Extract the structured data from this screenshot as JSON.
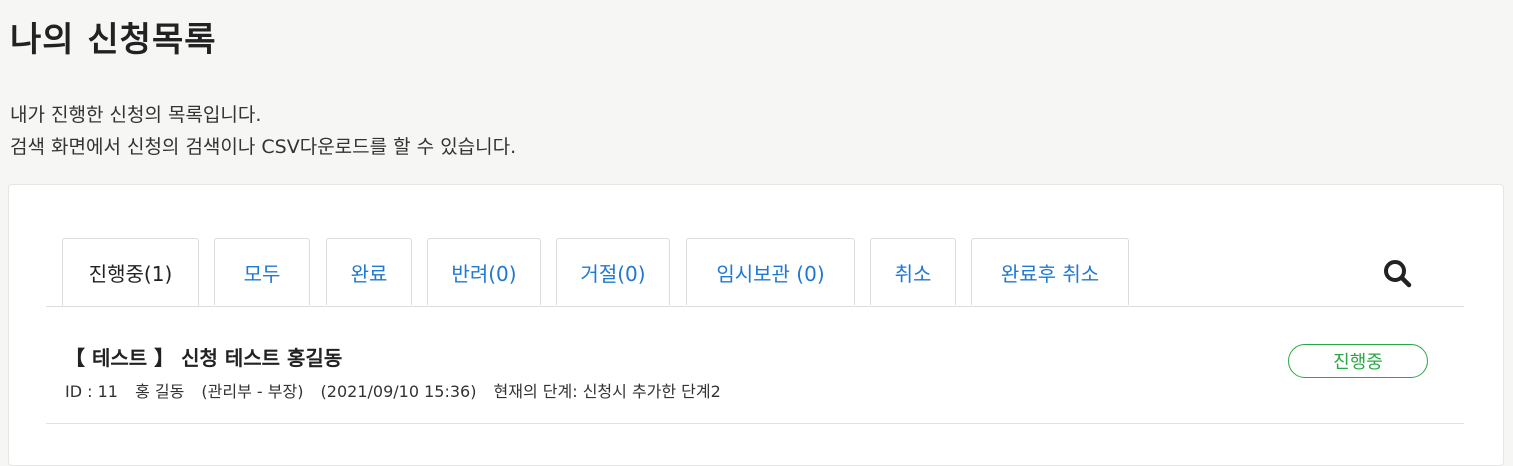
{
  "header": {
    "title": "나의 신청목록",
    "description_line1": "내가 진행한 신청의 목록입니다.",
    "description_line2": "검색 화면에서 신청의 검색이나 CSV다운로드를 할 수 있습니다."
  },
  "tabs": [
    {
      "label": "진행중(1)",
      "active": true
    },
    {
      "label": "모두",
      "active": false
    },
    {
      "label": "완료",
      "active": false
    },
    {
      "label": "반려(0)",
      "active": false
    },
    {
      "label": "거절(0)",
      "active": false
    },
    {
      "label": "임시보관 (0)",
      "active": false
    },
    {
      "label": "취소",
      "active": false
    },
    {
      "label": "완료후 취소",
      "active": false
    }
  ],
  "search": {
    "icon": "search-icon"
  },
  "items": [
    {
      "title": "【 테스트 】 신청 테스트 홍길동",
      "id": "ID : 11",
      "applicant": "홍 길동",
      "department": "(관리부 - 부장)",
      "datetime": "(2021/09/10 15:36)",
      "stage": "현재의 단계: 신청시 추가한 단계2",
      "status": "진행중"
    }
  ],
  "colors": {
    "link": "#1f78d1",
    "status_green": "#28a745",
    "background": "#f6f6f5"
  }
}
